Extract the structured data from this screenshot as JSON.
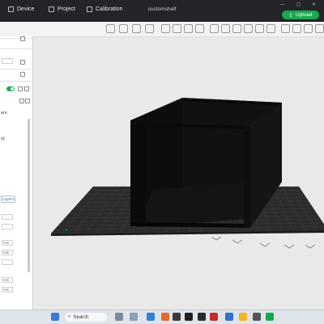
{
  "window": {
    "title": "customshelf",
    "tabs": [
      {
        "label": "Device"
      },
      {
        "label": "Project"
      },
      {
        "label": "Calibration"
      }
    ],
    "upload_label": "Upload"
  },
  "sidebar": {
    "fragments": [
      "ers",
      "o)",
      "Layers",
      "mm",
      "mm",
      "mm",
      "mm"
    ]
  },
  "taskbar": {
    "search_placeholder": "Search"
  },
  "colors": {
    "accent": "#19a84e",
    "titlebar": "#222427",
    "viewport_bg": "#e9e9e9",
    "plate": "#2b2b2b",
    "model": "#0d0d0d"
  }
}
